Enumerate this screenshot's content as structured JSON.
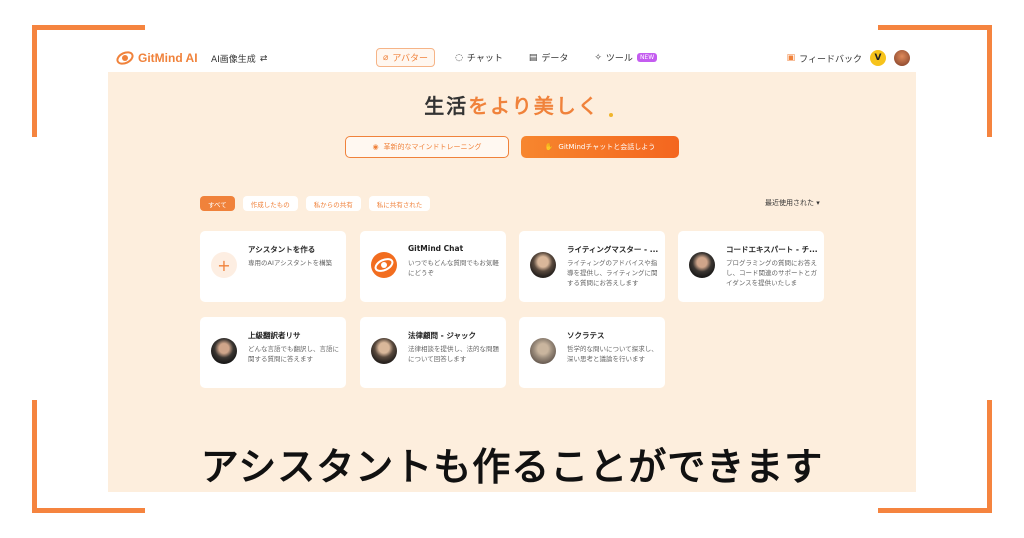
{
  "brand": {
    "name": "GitMind AI",
    "accent": "#f0823b",
    "frame_color": "#f5843f"
  },
  "header": {
    "mode_switch": "AI画像生成",
    "nav": [
      {
        "label": "アバター",
        "icon": "avatar-icon",
        "active": true
      },
      {
        "label": "チャット",
        "icon": "chat-icon"
      },
      {
        "label": "データ",
        "icon": "data-icon"
      },
      {
        "label": "ツール",
        "icon": "tool-icon",
        "badge": "NEW"
      }
    ],
    "feedback": "フィードバック",
    "vip_badge": "V"
  },
  "hero": {
    "prefix": "生活",
    "highlight": "をより美しく"
  },
  "cta": {
    "training": "革新的なマインドトレーニング",
    "chat": "GitMindチャットと会話しよう"
  },
  "filters": [
    "すべて",
    "作成したもの",
    "私からの共有",
    "私に共有された"
  ],
  "sort_label": "最近使用された ▾",
  "cards": [
    {
      "title": "アシスタントを作る",
      "desc": "専用のAIアシスタントを構築",
      "avatar": "plus-icon"
    },
    {
      "title": "GitMind Chat",
      "desc": "いつでもどんな質問でもお気軽にどうぞ",
      "avatar": "gitmind-logo-icon"
    },
    {
      "title": "ライティングマスター - ...",
      "desc": "ライティングのアドバイスや指導を提供し、ライティングに関する質問にお答えします",
      "avatar": "writer-avatar"
    },
    {
      "title": "コードエキスパート - チ...",
      "desc": "プログラミングの質問にお答えし、コード関連のサポートとガイダンスを提供いたしま",
      "avatar": "coder-avatar"
    },
    {
      "title": "上級翻訳者リサ",
      "desc": "どんな言語でも翻訳し、言語に関する質問に答えます",
      "avatar": "translator-avatar"
    },
    {
      "title": "法律顧問 - ジャック",
      "desc": "法律相談を提供し、法的な問題について回答します",
      "avatar": "lawyer-avatar"
    },
    {
      "title": "ソクラテス",
      "desc": "哲学的な問いについて探求し、深い思考と議論を行います",
      "avatar": "socrates-avatar"
    }
  ],
  "caption": "アシスタントも作ることができます"
}
